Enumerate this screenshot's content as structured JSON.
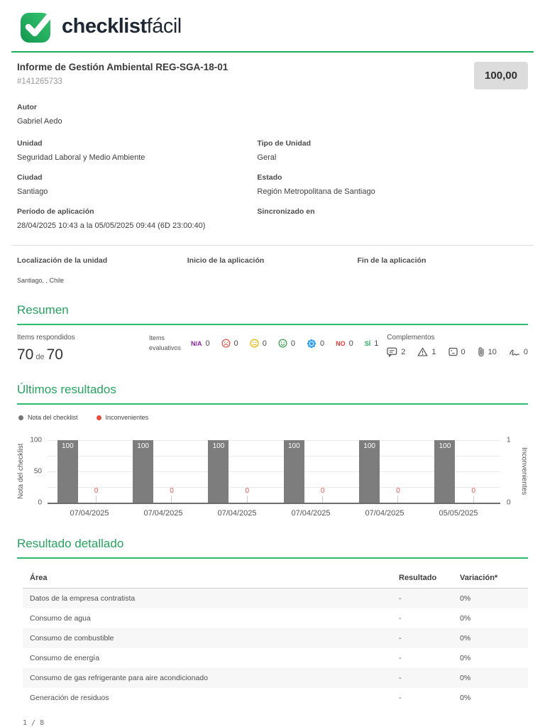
{
  "logo": {
    "bold": "checklist",
    "light": "fácil"
  },
  "report": {
    "title": "Informe de Gestión Ambiental REG-SGA-18-01",
    "number": "#141265733",
    "score": "100,00"
  },
  "meta": {
    "autor": {
      "label": "Autor",
      "value": "Gabriel Aedo"
    },
    "unidad": {
      "label": "Unidad",
      "value": "Seguridad Laboral y Medio Ambiente"
    },
    "tipo_unidad": {
      "label": "Tipo de Unidad",
      "value": "Geral"
    },
    "ciudad": {
      "label": "Ciudad",
      "value": "Santiago"
    },
    "estado": {
      "label": "Estado",
      "value": "Región Metropolitana de Santiago"
    },
    "periodo": {
      "label": "Período de aplicación",
      "value": "28/04/2025 10:43 a la 05/05/2025 09:44 (6D 23:00:40)"
    },
    "sincronizado": {
      "label": "Sincronizado en",
      "value": ""
    }
  },
  "location": {
    "localizacion": {
      "label": "Localización de la unidad",
      "value": "Santiago, , Chile"
    },
    "inicio": {
      "label": "Inicio de la aplicación"
    },
    "fin": {
      "label": "Fin de la aplicación"
    }
  },
  "resumen": {
    "title": "Resumen",
    "respondidos": {
      "label": "Items respondidos",
      "value": "70",
      "sep": "de",
      "total": "70"
    },
    "evaluativos": {
      "label_line1": "Items",
      "label_line2": "evaluativos",
      "items": [
        {
          "icon": "na-label",
          "text": "N/A",
          "color": "#8e24aa",
          "count": "0"
        },
        {
          "icon": "sad-face-icon",
          "color": "#e8554d",
          "count": "0"
        },
        {
          "icon": "neutral-face-icon",
          "color": "#f0b400",
          "count": "0"
        },
        {
          "icon": "happy-face-icon",
          "color": "#3fa14f",
          "count": "0"
        },
        {
          "icon": "badge-icon",
          "color": "#2e9df0",
          "count": "0"
        },
        {
          "icon": "no-label",
          "text": "NO",
          "color": "#e53935",
          "count": "0"
        },
        {
          "icon": "si-label",
          "text": "SÍ",
          "color": "#27a560",
          "count": "1"
        }
      ]
    },
    "complementos": {
      "label": "Complementos",
      "items": [
        {
          "icon": "comment-icon",
          "count": "2"
        },
        {
          "icon": "warning-icon",
          "count": "1"
        },
        {
          "icon": "image-icon",
          "count": "0"
        },
        {
          "icon": "attachment-icon",
          "count": "10"
        },
        {
          "icon": "signature-icon",
          "count": "0"
        }
      ]
    }
  },
  "chart_data": {
    "type": "bar",
    "title": "Últimos resultados",
    "legend": [
      {
        "label": "Nota del checklist",
        "color": "#757575"
      },
      {
        "label": "Inconvenientes",
        "color": "#e74c3c"
      }
    ],
    "categories": [
      "07/04/2025",
      "07/04/2025",
      "07/04/2025",
      "07/04/2025",
      "07/04/2025",
      "05/05/2025"
    ],
    "series": [
      {
        "name": "Nota del checklist",
        "type": "bar",
        "color": "#7d7d7d",
        "values": [
          100,
          100,
          100,
          100,
          100,
          100
        ]
      },
      {
        "name": "Inconvenientes",
        "type": "point",
        "color": "#e8554d",
        "values": [
          0,
          0,
          0,
          0,
          0,
          0
        ]
      }
    ],
    "left_axis": {
      "label": "Nota del checklist",
      "ticks": [
        "100",
        "50",
        "0"
      ],
      "max": 100
    },
    "right_axis": {
      "label": "Inconvenientes",
      "ticks": [
        "1",
        "0"
      ],
      "max": 1
    },
    "grid": true
  },
  "detalle": {
    "title": "Resultado detallado",
    "columns": [
      "Área",
      "Resultado",
      "Variación*"
    ],
    "rows": [
      {
        "area": "Datos de la empresa contratista",
        "resultado": "-",
        "variacion": "0%"
      },
      {
        "area": "Consumo de agua",
        "resultado": "-",
        "variacion": "0%"
      },
      {
        "area": "Consumo de combustible",
        "resultado": "-",
        "variacion": "0%"
      },
      {
        "area": "Consumo de energía",
        "resultado": "-",
        "variacion": "0%"
      },
      {
        "area": "Consumo de gas refrigerante para aire acondicionado",
        "resultado": "-",
        "variacion": "0%"
      },
      {
        "area": "Generación de residuos",
        "resultado": "-",
        "variacion": "0%"
      }
    ]
  },
  "footer": {
    "page": "1 / 8"
  }
}
